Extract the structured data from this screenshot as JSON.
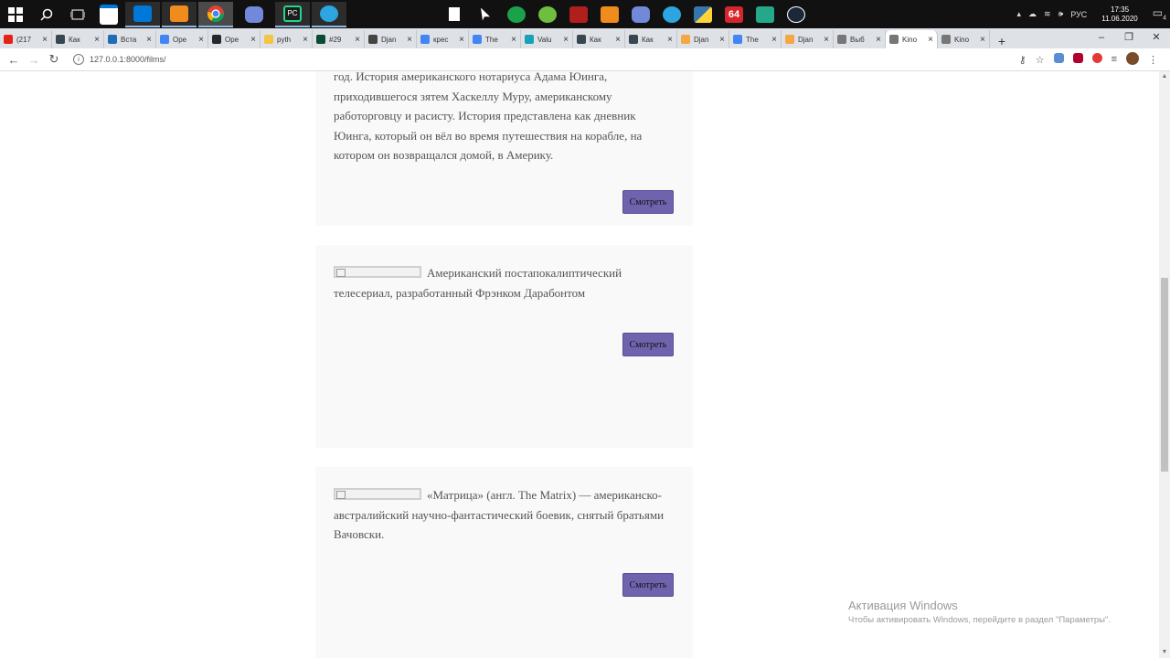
{
  "taskbar": {
    "lang": "РУС",
    "time": "17:35",
    "date": "11.06.2020",
    "badge_64": "64",
    "notif_count": "4"
  },
  "tabs": [
    {
      "title": "(217",
      "color": "#e62117"
    },
    {
      "title": "Как",
      "color": "#37474f"
    },
    {
      "title": "Вста",
      "color": "#1e6eb5"
    },
    {
      "title": "Ope",
      "color": "#4285f4"
    },
    {
      "title": "Ope",
      "color": "#24292e"
    },
    {
      "title": "pyth",
      "color": "#f4c542"
    },
    {
      "title": "#29",
      "color": "#0c4b33"
    },
    {
      "title": "Djan",
      "color": "#444444"
    },
    {
      "title": "крес",
      "color": "#4285f4"
    },
    {
      "title": "The",
      "color": "#4285f4"
    },
    {
      "title": "Valu",
      "color": "#17a2b8"
    },
    {
      "title": "Как",
      "color": "#37474f"
    },
    {
      "title": "Как",
      "color": "#37474f"
    },
    {
      "title": "Djan",
      "color": "#f4a742"
    },
    {
      "title": "The",
      "color": "#4285f4"
    },
    {
      "title": "Djan",
      "color": "#f4a742"
    },
    {
      "title": "Выб",
      "color": "#777777"
    },
    {
      "title": "Kino",
      "color": "#777777",
      "active": true
    },
    {
      "title": "Kino",
      "color": "#777777"
    }
  ],
  "address": {
    "url": "127.0.0.1:8000/films/"
  },
  "films": [
    {
      "desc": "год. История американского нотариуса Адама Юинга, приходившегося зятем Хаскеллу Муру, американскому работорговцу и расисту. История представлена как дневник Юинга, который он вёл во время путешествия на корабле, на котором он возвращался домой, в Америку.",
      "button": "Смотреть"
    },
    {
      "desc": "Американский постапокалиптический телесериал, разработанный Фрэнком Дарабонтом",
      "button": "Смотреть"
    },
    {
      "desc": "«Матрица» (англ. The Matrix) — американско-австралийский научно-фантастический боевик, снятый братьями Вачовски.",
      "button": "Смотреть"
    }
  ],
  "watermark": {
    "title": "Активация Windows",
    "subtitle": "Чтобы активировать Windows, перейдите в раздел \"Параметры\"."
  },
  "colors": {
    "button": "#6f63ad",
    "card_bg": "#f9f9f9",
    "text": "#555555"
  }
}
